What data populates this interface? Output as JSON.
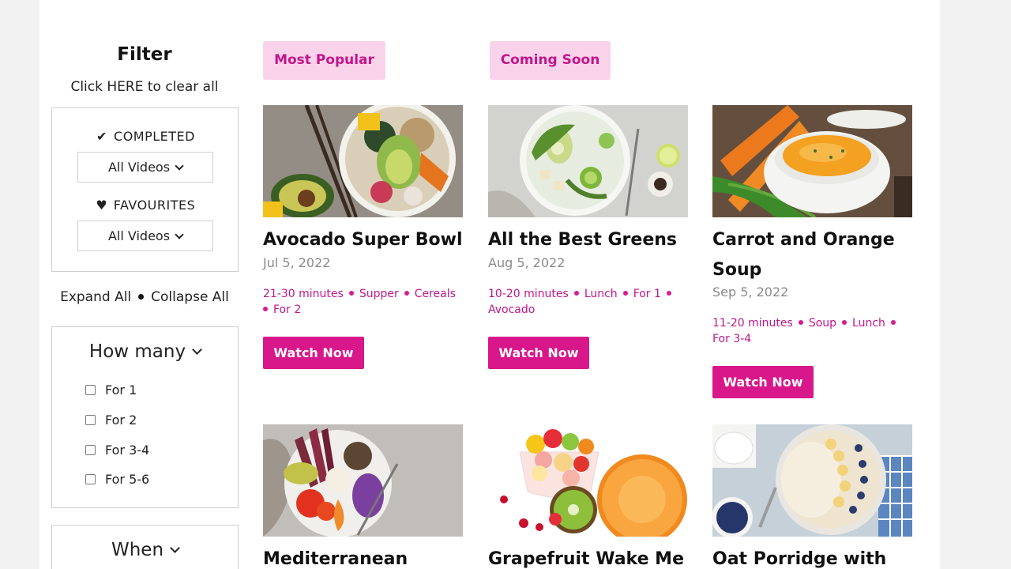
{
  "sidebar": {
    "title": "Filter",
    "clear_all": "Click HERE to clear all",
    "completed": {
      "label": "COMPLETED",
      "icon": "checkmark-icon",
      "value": "All Videos"
    },
    "favourites": {
      "label": "FAVOURITES",
      "icon": "heart-icon",
      "value": "All Videos"
    },
    "expand_all": "Expand All",
    "collapse_all": "Collapse All",
    "how_many": {
      "heading": "How many",
      "options": [
        "For 1",
        "For 2",
        "For 3-4",
        "For 5-6"
      ]
    },
    "when": {
      "heading": "When"
    }
  },
  "tabs": [
    "Most Popular",
    "Coming Soon"
  ],
  "accent_color": "#d8178b",
  "tab_bg_color": "#f9d3ea",
  "recipes": [
    {
      "title": "Avocado Super Bowl",
      "date": "Jul 5, 2022",
      "tags": [
        "21-30 minutes",
        "Supper",
        "Cereals",
        "For 2"
      ],
      "button": "Watch Now"
    },
    {
      "title": "All the Best Greens",
      "date": "Aug 5, 2022",
      "tags": [
        "10-20 minutes",
        "Lunch",
        "For 1",
        "Avocado"
      ],
      "button": "Watch Now"
    },
    {
      "title": "Carrot and Orange Soup",
      "date": "Sep 5, 2022",
      "tags": [
        "11-20 minutes",
        "Soup",
        "Lunch",
        "For 3-4"
      ],
      "button": "Watch Now"
    },
    {
      "title": "Mediterranean"
    },
    {
      "title": "Grapefruit Wake Me"
    },
    {
      "title": "Oat Porridge with"
    }
  ]
}
